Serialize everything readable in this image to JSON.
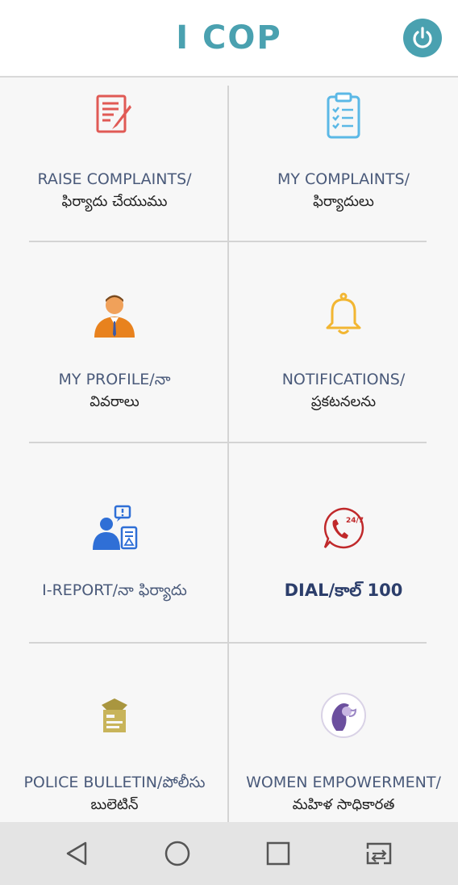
{
  "header": {
    "title": "I COP"
  },
  "tiles": [
    {
      "en": "RAISE COMPLAINTS/",
      "te": "ఫిర్యాదు చేయుము",
      "icon": "complaint-form-icon"
    },
    {
      "en": "MY COMPLAINTS/",
      "te": "ఫిర్యాదులు",
      "icon": "clipboard-checklist-icon"
    },
    {
      "en": "MY PROFILE/నా",
      "te": "వివరాలు",
      "icon": "user-profile-icon"
    },
    {
      "en": "NOTIFICATIONS/",
      "te": "ప్రకటనలను",
      "icon": "bell-icon"
    },
    {
      "en": "I-REPORT/నా ఫిర్యాదు",
      "icon": "report-officer-icon"
    },
    {
      "en": "DIAL/కాల్ 100",
      "icon": "phone-24-7-icon"
    },
    {
      "en": "POLICE BULLETIN/పోలీసు",
      "te": "బులెటిన్",
      "icon": "police-bulletin-icon"
    },
    {
      "en": "WOMEN EMPOWERMENT/",
      "te": "మహిళ సాధికారత",
      "icon": "women-empowerment-icon"
    }
  ],
  "colors": {
    "accent": "#4aa1b0",
    "label": "#4a5a7a"
  }
}
